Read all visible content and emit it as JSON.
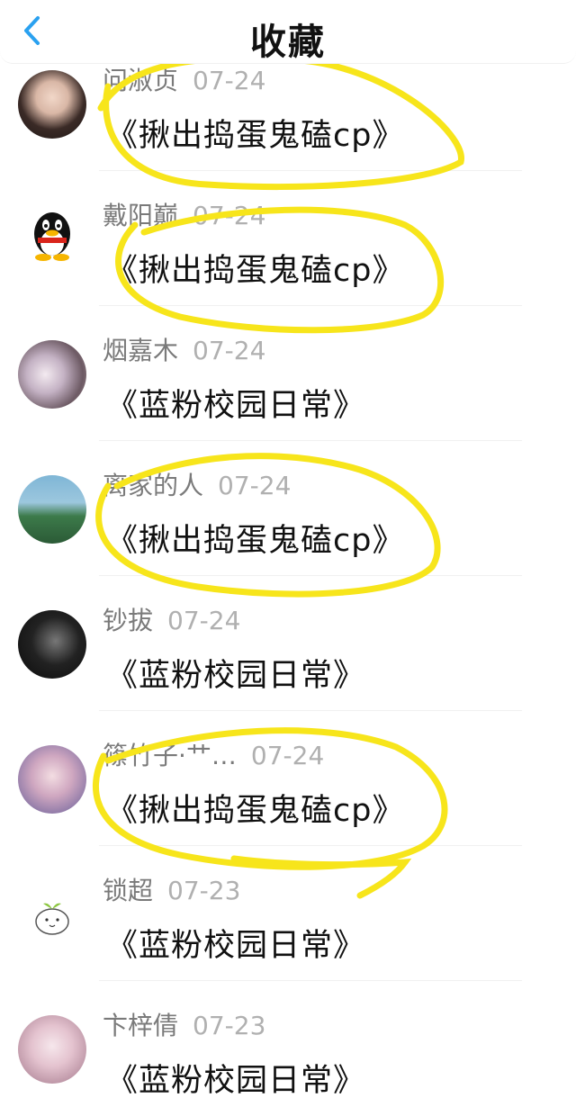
{
  "header": {
    "title": "收藏",
    "back_icon": "chevron-left-icon",
    "accent": "#2aa1f0"
  },
  "items": [
    {
      "user": "问淑贞",
      "date": "07-24",
      "content": "《揪出捣蛋鬼磕cp》"
    },
    {
      "user": "戴阳巅",
      "date": "07-24",
      "content": "《揪出捣蛋鬼磕cp》"
    },
    {
      "user": "烟嘉木",
      "date": "07-24",
      "content": "《蓝粉校园日常》"
    },
    {
      "user": "离家的人",
      "date": "07-24",
      "content": "《揪出捣蛋鬼磕cp》"
    },
    {
      "user": "钞拔",
      "date": "07-24",
      "content": "《蓝粉校园日常》"
    },
    {
      "user": "篠竹子·艹…",
      "date": "07-24",
      "content": "《揪出捣蛋鬼磕cp》"
    },
    {
      "user": "锁超",
      "date": "07-23",
      "content": "《蓝粉校园日常》"
    },
    {
      "user": "卞梓倩",
      "date": "07-23",
      "content": "《蓝粉校园日常》"
    }
  ],
  "annotation_color": "#f7e51b"
}
